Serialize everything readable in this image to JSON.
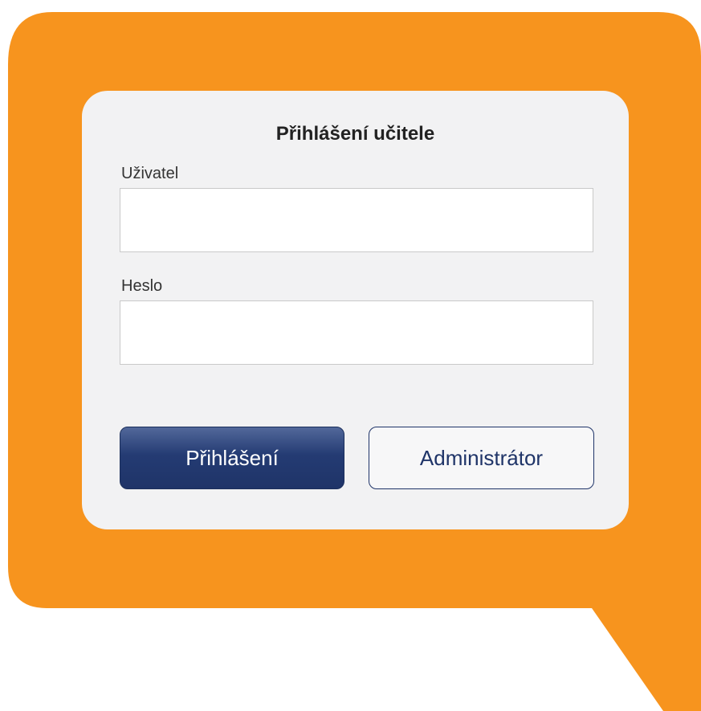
{
  "login_form": {
    "title": "Přihlášení učitele",
    "username_label": "Uživatel",
    "username_value": "",
    "password_label": "Heslo",
    "password_value": "",
    "login_button_label": "Přihlášení",
    "admin_button_label": "Administrátor"
  },
  "colors": {
    "background_accent": "#f7941e",
    "card_background": "#f2f2f3",
    "primary_button": "#243b73",
    "secondary_button_border": "#1f3468"
  },
  "icons": {
    "background_shape": "speech-bubble"
  }
}
